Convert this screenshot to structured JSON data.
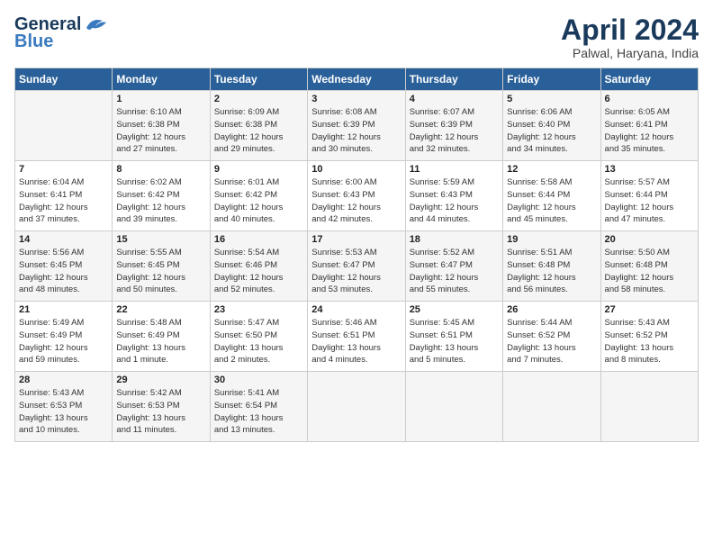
{
  "header": {
    "logo_general": "General",
    "logo_blue": "Blue",
    "month_title": "April 2024",
    "location": "Palwal, Haryana, India"
  },
  "days_of_week": [
    "Sunday",
    "Monday",
    "Tuesday",
    "Wednesday",
    "Thursday",
    "Friday",
    "Saturday"
  ],
  "weeks": [
    [
      {
        "day": "",
        "content": ""
      },
      {
        "day": "1",
        "content": "Sunrise: 6:10 AM\nSunset: 6:38 PM\nDaylight: 12 hours\nand 27 minutes."
      },
      {
        "day": "2",
        "content": "Sunrise: 6:09 AM\nSunset: 6:38 PM\nDaylight: 12 hours\nand 29 minutes."
      },
      {
        "day": "3",
        "content": "Sunrise: 6:08 AM\nSunset: 6:39 PM\nDaylight: 12 hours\nand 30 minutes."
      },
      {
        "day": "4",
        "content": "Sunrise: 6:07 AM\nSunset: 6:39 PM\nDaylight: 12 hours\nand 32 minutes."
      },
      {
        "day": "5",
        "content": "Sunrise: 6:06 AM\nSunset: 6:40 PM\nDaylight: 12 hours\nand 34 minutes."
      },
      {
        "day": "6",
        "content": "Sunrise: 6:05 AM\nSunset: 6:41 PM\nDaylight: 12 hours\nand 35 minutes."
      }
    ],
    [
      {
        "day": "7",
        "content": "Sunrise: 6:04 AM\nSunset: 6:41 PM\nDaylight: 12 hours\nand 37 minutes."
      },
      {
        "day": "8",
        "content": "Sunrise: 6:02 AM\nSunset: 6:42 PM\nDaylight: 12 hours\nand 39 minutes."
      },
      {
        "day": "9",
        "content": "Sunrise: 6:01 AM\nSunset: 6:42 PM\nDaylight: 12 hours\nand 40 minutes."
      },
      {
        "day": "10",
        "content": "Sunrise: 6:00 AM\nSunset: 6:43 PM\nDaylight: 12 hours\nand 42 minutes."
      },
      {
        "day": "11",
        "content": "Sunrise: 5:59 AM\nSunset: 6:43 PM\nDaylight: 12 hours\nand 44 minutes."
      },
      {
        "day": "12",
        "content": "Sunrise: 5:58 AM\nSunset: 6:44 PM\nDaylight: 12 hours\nand 45 minutes."
      },
      {
        "day": "13",
        "content": "Sunrise: 5:57 AM\nSunset: 6:44 PM\nDaylight: 12 hours\nand 47 minutes."
      }
    ],
    [
      {
        "day": "14",
        "content": "Sunrise: 5:56 AM\nSunset: 6:45 PM\nDaylight: 12 hours\nand 48 minutes."
      },
      {
        "day": "15",
        "content": "Sunrise: 5:55 AM\nSunset: 6:45 PM\nDaylight: 12 hours\nand 50 minutes."
      },
      {
        "day": "16",
        "content": "Sunrise: 5:54 AM\nSunset: 6:46 PM\nDaylight: 12 hours\nand 52 minutes."
      },
      {
        "day": "17",
        "content": "Sunrise: 5:53 AM\nSunset: 6:47 PM\nDaylight: 12 hours\nand 53 minutes."
      },
      {
        "day": "18",
        "content": "Sunrise: 5:52 AM\nSunset: 6:47 PM\nDaylight: 12 hours\nand 55 minutes."
      },
      {
        "day": "19",
        "content": "Sunrise: 5:51 AM\nSunset: 6:48 PM\nDaylight: 12 hours\nand 56 minutes."
      },
      {
        "day": "20",
        "content": "Sunrise: 5:50 AM\nSunset: 6:48 PM\nDaylight: 12 hours\nand 58 minutes."
      }
    ],
    [
      {
        "day": "21",
        "content": "Sunrise: 5:49 AM\nSunset: 6:49 PM\nDaylight: 12 hours\nand 59 minutes."
      },
      {
        "day": "22",
        "content": "Sunrise: 5:48 AM\nSunset: 6:49 PM\nDaylight: 13 hours\nand 1 minute."
      },
      {
        "day": "23",
        "content": "Sunrise: 5:47 AM\nSunset: 6:50 PM\nDaylight: 13 hours\nand 2 minutes."
      },
      {
        "day": "24",
        "content": "Sunrise: 5:46 AM\nSunset: 6:51 PM\nDaylight: 13 hours\nand 4 minutes."
      },
      {
        "day": "25",
        "content": "Sunrise: 5:45 AM\nSunset: 6:51 PM\nDaylight: 13 hours\nand 5 minutes."
      },
      {
        "day": "26",
        "content": "Sunrise: 5:44 AM\nSunset: 6:52 PM\nDaylight: 13 hours\nand 7 minutes."
      },
      {
        "day": "27",
        "content": "Sunrise: 5:43 AM\nSunset: 6:52 PM\nDaylight: 13 hours\nand 8 minutes."
      }
    ],
    [
      {
        "day": "28",
        "content": "Sunrise: 5:43 AM\nSunset: 6:53 PM\nDaylight: 13 hours\nand 10 minutes."
      },
      {
        "day": "29",
        "content": "Sunrise: 5:42 AM\nSunset: 6:53 PM\nDaylight: 13 hours\nand 11 minutes."
      },
      {
        "day": "30",
        "content": "Sunrise: 5:41 AM\nSunset: 6:54 PM\nDaylight: 13 hours\nand 13 minutes."
      },
      {
        "day": "",
        "content": ""
      },
      {
        "day": "",
        "content": ""
      },
      {
        "day": "",
        "content": ""
      },
      {
        "day": "",
        "content": ""
      }
    ]
  ]
}
